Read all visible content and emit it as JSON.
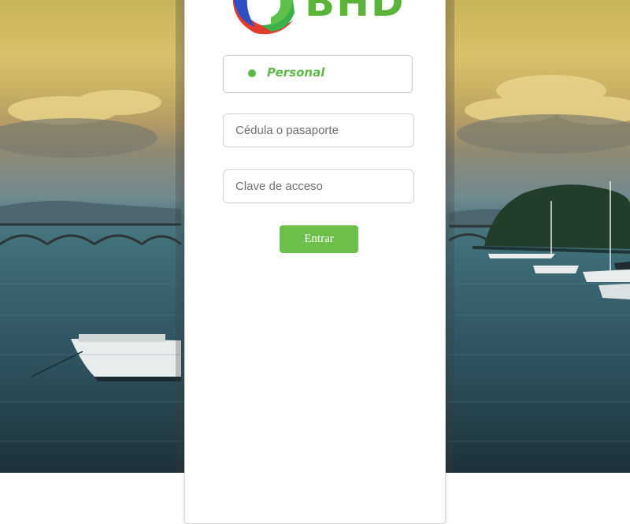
{
  "brand": {
    "name": "BHD",
    "logo_icon": "bhd-swirl-logo",
    "brand_green": "#5cb33a"
  },
  "login": {
    "segment_label": "Personal",
    "id_placeholder": "Cédula o pasaporte",
    "id_value": "",
    "password_placeholder": "Clave de acceso",
    "password_value": "",
    "submit_label": "Entrar",
    "accent": "#6cc04a"
  },
  "background": {
    "image": "sunset-bay-photo"
  }
}
